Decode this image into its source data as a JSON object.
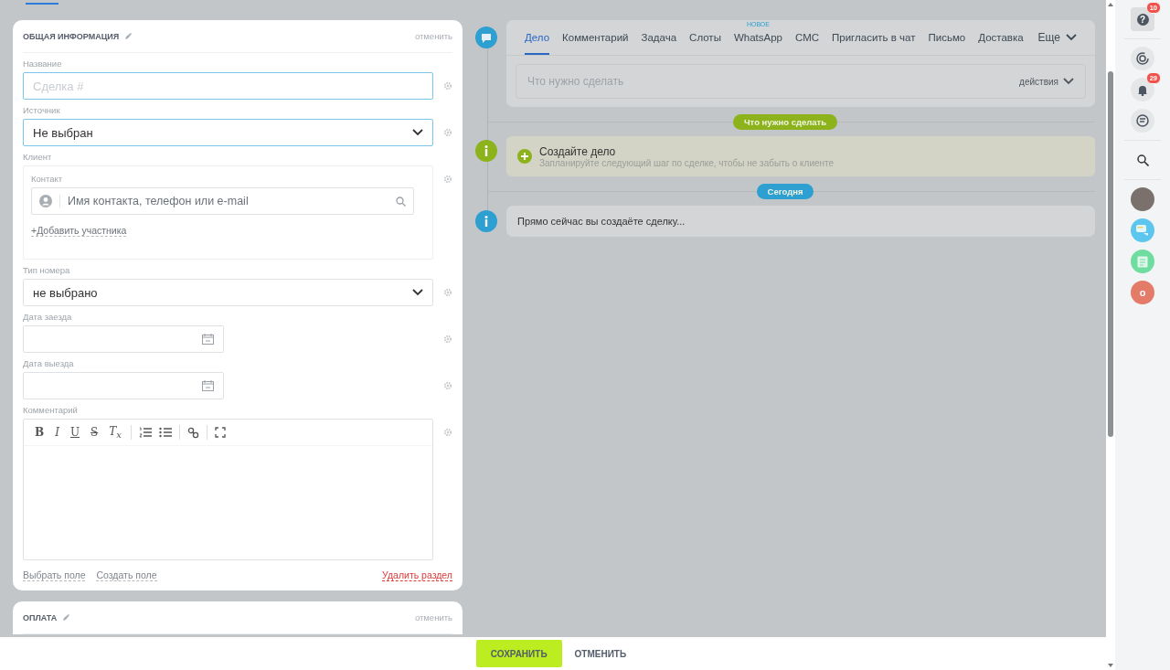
{
  "sections": [
    {
      "title": "ОБЩАЯ ИНФОРМАЦИЯ",
      "cancel": "отменить",
      "fields": [
        {
          "kind": "text",
          "label": "Название",
          "placeholder": "Сделка #",
          "highlighted": true
        },
        {
          "kind": "select",
          "label": "Источник",
          "value": "Не выбран",
          "highlighted": true
        },
        {
          "kind": "client",
          "label": "Клиент",
          "contact_label": "Контакт",
          "placeholder": "Имя контакта, телефон или e-mail",
          "add_link": "+Добавить участника"
        },
        {
          "kind": "select",
          "label": "Тип номера",
          "value": "не выбрано",
          "highlighted": false
        },
        {
          "kind": "date",
          "label": "Дата заезда"
        },
        {
          "kind": "date",
          "label": "Дата выезда"
        },
        {
          "kind": "editor",
          "label": "Комментарий",
          "tools": [
            {
              "kind": "bold",
              "label": "B"
            },
            {
              "kind": "italic",
              "label": "I"
            },
            {
              "kind": "underline",
              "label": "U"
            },
            {
              "kind": "strike",
              "label": "S"
            },
            {
              "kind": "clear",
              "label": "T$_{x}$"
            },
            {
              "kind": "sep"
            },
            {
              "kind": "numbered"
            },
            {
              "kind": "bulleted"
            },
            {
              "kind": "sep"
            },
            {
              "kind": "link"
            },
            {
              "kind": "sep"
            },
            {
              "kind": "fullscreen"
            }
          ]
        }
      ],
      "footer_links": [
        "Выбрать поле",
        "Создать поле"
      ],
      "delete_link": "Удалить раздел"
    },
    {
      "title": "ОПЛАТА",
      "cancel": "отменить"
    }
  ],
  "timeline": {
    "tabs": [
      {
        "label": "Дело",
        "selected": true
      },
      {
        "label": "Комментарий",
        "selected": false
      },
      {
        "label": "Задача",
        "selected": false
      },
      {
        "label": "Слоты",
        "selected": false
      },
      {
        "label": "WhatsApp",
        "selected": false,
        "badge": "НОВОЕ"
      },
      {
        "label": "СМС",
        "selected": false
      },
      {
        "label": "Пригласить в чат",
        "selected": false
      },
      {
        "label": "Письмо",
        "selected": false
      },
      {
        "label": "Доставка",
        "selected": false
      }
    ],
    "more": "Еще",
    "input_placeholder": "Что нужно сделать",
    "actions": "действия",
    "entries": [
      {
        "kind": "divider",
        "label": "Что нужно сделать",
        "color": "#8db31c"
      },
      {
        "kind": "todo",
        "title": "Создайте дело",
        "subtitle": "Запланируйте следующий шаг по сделке, чтобы не забыть о клиенте",
        "color": "#8db31c"
      },
      {
        "kind": "divider",
        "label": "Сегодня",
        "color": "#2d9fd0"
      },
      {
        "kind": "info",
        "text": "Прямо сейчас вы создаёте сделку...",
        "color": "#2d9fd0"
      }
    ]
  },
  "sidebar": [
    {
      "kind": "help",
      "glyph": "?",
      "badge": "10"
    },
    {
      "kind": "sep"
    },
    {
      "kind": "target"
    },
    {
      "kind": "bell",
      "badge": "29"
    },
    {
      "kind": "chat"
    },
    {
      "kind": "sep"
    },
    {
      "kind": "search"
    },
    {
      "kind": "sep"
    },
    {
      "kind": "photo"
    },
    {
      "kind": "messages"
    },
    {
      "kind": "news"
    },
    {
      "kind": "letter",
      "glyph": "o"
    }
  ],
  "footer": {
    "save": "СОХРАНИТЬ",
    "cancel": "ОТМЕНИТЬ"
  }
}
